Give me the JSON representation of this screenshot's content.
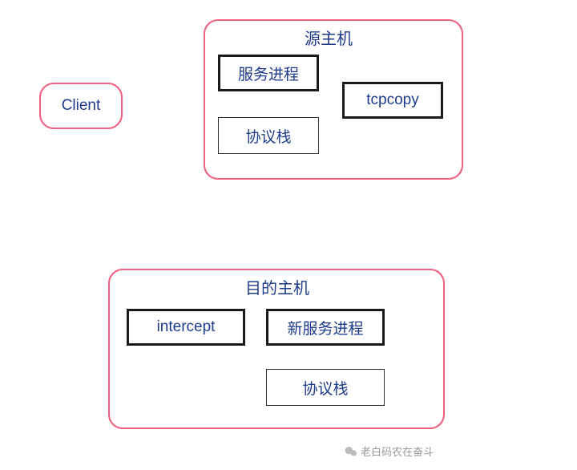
{
  "client": {
    "label": "Client"
  },
  "sourceHost": {
    "title": "源主机",
    "serviceProcess": "服务进程",
    "tcpcopy": "tcpcopy",
    "protocolStack": "协议栈"
  },
  "destHost": {
    "title": "目的主机",
    "intercept": "intercept",
    "newServiceProcess": "新服务进程",
    "protocolStack": "协议栈"
  },
  "watermark": "老白码农在奋斗"
}
